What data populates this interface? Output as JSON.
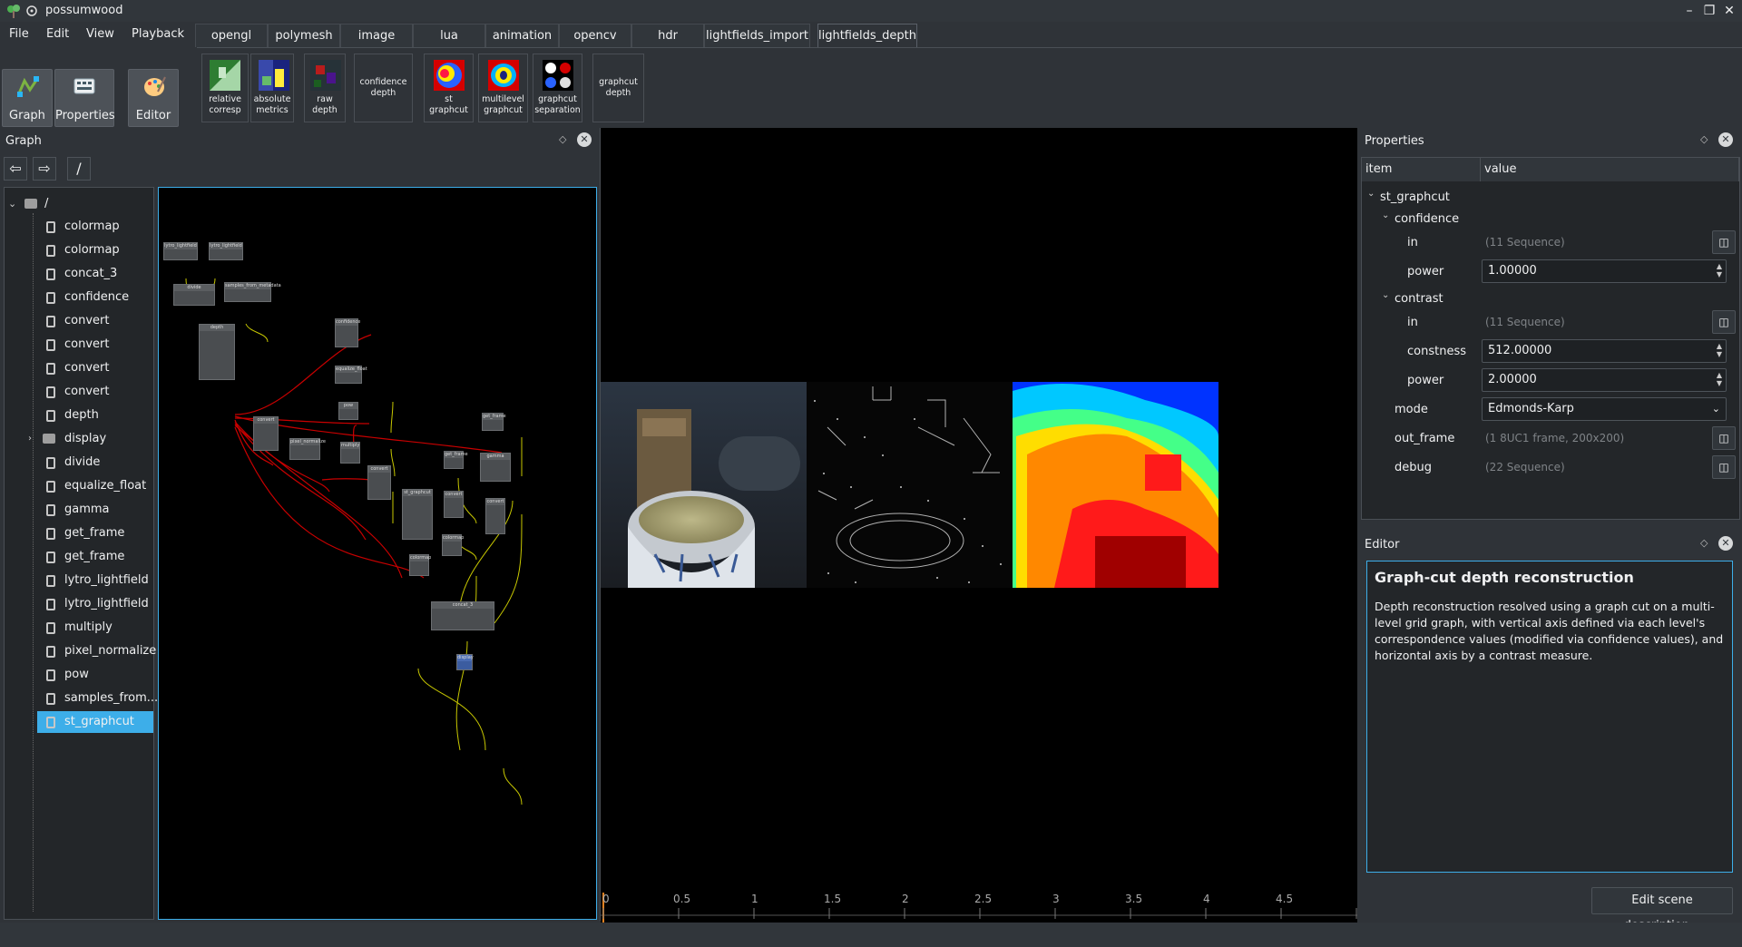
{
  "window": {
    "title": "possumwood"
  },
  "menu": [
    "File",
    "Edit",
    "View",
    "Playback"
  ],
  "tabs": [
    {
      "label": "opengl"
    },
    {
      "label": "polymesh"
    },
    {
      "label": "image"
    },
    {
      "label": "lua"
    },
    {
      "label": "animation"
    },
    {
      "label": "opencv"
    },
    {
      "label": "hdr"
    },
    {
      "label": "lightfields_import"
    },
    {
      "label": "lightfields_depth",
      "active": true
    }
  ],
  "modes": {
    "graph": "Graph",
    "properties": "Properties",
    "editor": "Editor"
  },
  "tools": [
    {
      "line1": "relative",
      "line2": "corresp"
    },
    {
      "line1": "absolute",
      "line2": "metrics"
    },
    {
      "line1": "raw",
      "line2": "depth"
    },
    {
      "line1": "confidence",
      "line2": "depth"
    },
    {
      "line1": "st",
      "line2": "graphcut"
    },
    {
      "line1": "multilevel",
      "line2": "graphcut"
    },
    {
      "line1": "graphcut",
      "line2": "separation"
    },
    {
      "line1": "graphcut",
      "line2": "depth"
    }
  ],
  "graph_dock": {
    "title": "Graph",
    "path": "/",
    "root": "/",
    "nodes": [
      "colormap",
      "colormap",
      "concat_3",
      "confidence",
      "convert",
      "convert",
      "convert",
      "convert",
      "depth",
      "display",
      "divide",
      "equalize_float",
      "gamma",
      "get_frame",
      "get_frame",
      "lytro_lightfield",
      "lytro_lightfield",
      "multiply",
      "pixel_normalize",
      "pow",
      "samples_from...",
      "st_graphcut"
    ]
  },
  "timeline": {
    "ticks": [
      "0",
      "0.5",
      "1",
      "1.5",
      "2",
      "2.5",
      "3",
      "3.5",
      "4",
      "4.5"
    ]
  },
  "properties": {
    "title": "Properties",
    "col_item": "item",
    "col_value": "value",
    "root": "st_graphcut",
    "confidence": {
      "label": "confidence",
      "in_label": "in",
      "in_value": "(11 Sequence)",
      "power_label": "power",
      "power_value": "1.00000"
    },
    "contrast": {
      "label": "contrast",
      "in_label": "in",
      "in_value": "(11 Sequence)",
      "constness_label": "constness",
      "constness_value": "512.00000",
      "power_label": "power",
      "power_value": "2.00000"
    },
    "mode_label": "mode",
    "mode_value": "Edmonds-Karp",
    "out_frame_label": "out_frame",
    "out_frame_value": "(1 8UC1 frame, 200x200)",
    "debug_label": "debug",
    "debug_value": "(22 Sequence)"
  },
  "editor": {
    "title": "Editor",
    "heading": "Graph-cut depth reconstruction",
    "body": "Depth reconstruction resolved using a graph cut on a multi-level grid graph, with vertical axis defined via each level's correspondence values (modified via confidence values), and horizontal axis by a contrast measure.",
    "button": "Edit scene description..."
  },
  "colors": {
    "accent": "#3daee9",
    "background": "#2f3338",
    "panel": "#232629"
  }
}
